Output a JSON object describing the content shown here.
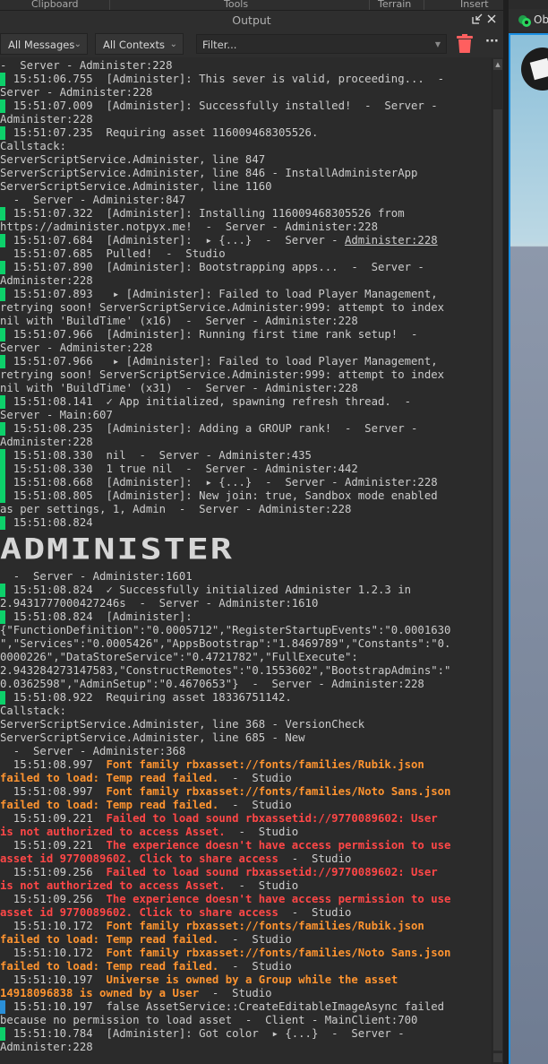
{
  "ribbon": [
    "Clipboard",
    "Tools",
    "Terrain",
    "Insert"
  ],
  "panel": {
    "title": "Output",
    "undock_icon": "undock-icon",
    "close_icon": "close-icon"
  },
  "toolbar": {
    "messages": "All Messages",
    "contexts": "All Contexts",
    "filter_placeholder": "Filter...",
    "clear_icon": "trash-icon",
    "more_icon": "more-icon",
    "more_label": "···"
  },
  "right_panel": {
    "tab_label": "Ob"
  },
  "colors": {
    "info": "#0dd06a",
    "client": "#2a8fd8",
    "warning": "#ff9430",
    "error": "#ff4747"
  },
  "banner": "ADMINISTER",
  "entries": [
    {
      "marker": null,
      "lines": [
        "-  Server - Administer:228"
      ]
    },
    {
      "marker": "info",
      "lines": [
        "  15:51:06.755  [Administer]: This sever is valid, proceeding...  -",
        "Server - Administer:228"
      ]
    },
    {
      "marker": "info",
      "lines": [
        "  15:51:07.009  [Administer]: Successfully installed!  -  Server -",
        "Administer:228"
      ]
    },
    {
      "marker": "info",
      "lines": [
        "  15:51:07.235  Requiring asset 116009468305526.",
        "Callstack:",
        "ServerScriptService.Administer, line 847",
        "ServerScriptService.Administer, line 846 - InstallAdministerApp",
        "ServerScriptService.Administer, line 1160",
        "  -  Server - Administer:847"
      ]
    },
    {
      "marker": "info",
      "lines": [
        "  15:51:07.322  [Administer]: Installing 116009468305526 from",
        "https://administer.notpyx.me!  -  Server - Administer:228"
      ]
    },
    {
      "marker": "info",
      "lines": [
        [
          [
            "  15:51:07.684  [Administer]:  ▸ {...}  -  Server - ",
            ""
          ],
          [
            "Administer:228",
            "u"
          ]
        ]
      ]
    },
    {
      "marker": null,
      "lines": [
        "  15:51:07.685  Pulled!  -  Studio"
      ]
    },
    {
      "marker": "info",
      "lines": [
        "  15:51:07.890  [Administer]: Bootstrapping apps...  -  Server -",
        "Administer:228"
      ]
    },
    {
      "marker": "info",
      "lines": [
        "  15:51:07.893   ▸ [Administer]: Failed to load Player Management,",
        "retrying soon! ServerScriptService.Administer:999: attempt to index",
        "nil with 'BuildTime' (x16)  -  Server - Administer:228"
      ]
    },
    {
      "marker": "info",
      "lines": [
        "  15:51:07.966  [Administer]: Running first time rank setup!  -",
        "Server - Administer:228"
      ]
    },
    {
      "marker": "info",
      "lines": [
        "  15:51:07.966   ▸ [Administer]: Failed to load Player Management,",
        "retrying soon! ServerScriptService.Administer:999: attempt to index",
        "nil with 'BuildTime' (x31)  -  Server - Administer:228"
      ]
    },
    {
      "marker": "info",
      "lines": [
        "  15:51:08.141  ✓ App initialized, spawning refresh thread.  -",
        "Server - Main:607"
      ]
    },
    {
      "marker": "info",
      "lines": [
        "  15:51:08.235  [Administer]: Adding a GROUP rank!  -  Server -",
        "Administer:228"
      ]
    },
    {
      "marker": "info",
      "lines": [
        "  15:51:08.330  nil  -  Server - Administer:435"
      ]
    },
    {
      "marker": "info",
      "lines": [
        "  15:51:08.330  1 true nil  -  Server - Administer:442"
      ]
    },
    {
      "marker": "info",
      "lines": [
        "  15:51:08.668  [Administer]:  ▸ {...}  -  Server - Administer:228"
      ]
    },
    {
      "marker": "info",
      "lines": [
        "  15:51:08.805  [Administer]: New join: true, Sandbox mode enabled",
        "as per settings, 1, Admin  -  Server - Administer:228"
      ]
    },
    {
      "marker": "info",
      "banner": true,
      "lines": [
        "  15:51:08.824",
        "  -  Server - Administer:1601"
      ]
    },
    {
      "marker": "info",
      "lines": [
        "  15:51:08.824  ✓ Successfully initialized Administer 1.2.3 in",
        "2.9431777000427246s  -  Server - Administer:1610"
      ]
    },
    {
      "marker": "info",
      "lines": [
        "  15:51:08.824  [Administer]:",
        "{\"FunctionDefinition\":\"0.0005712\",\"RegisterStartupEvents\":\"0.0001630",
        "\",\"Services\":\"0.0005426\",\"AppsBootstrap\":\"1.8469789\",\"Constants\":\"0.",
        "0000226\",\"DataStoreService\":\"0.4721782\",\"FullExecute\":",
        "2.943284273147583,\"ConstructRemotes\":\"0.1553602\",\"BootstrapAdmins\":\"",
        "0.0362598\",\"AdminSetup\":\"0.4670653\"}  -  Server - Administer:228"
      ]
    },
    {
      "marker": "info",
      "lines": [
        "  15:51:08.922  Requiring asset 18336751142.",
        "Callstack:",
        "ServerScriptService.Administer, line 368 - VersionCheck",
        "ServerScriptService.Administer, line 685 - New",
        "  -  Server - Administer:368"
      ]
    },
    {
      "marker": null,
      "lines": [
        [
          [
            "  15:51:08.997  ",
            ""
          ],
          [
            "Font family rbxasset://fonts/families/Rubik.json",
            "w"
          ]
        ],
        [
          [
            "failed to load: Temp read failed.",
            "w"
          ],
          [
            "  -  Studio",
            ""
          ]
        ]
      ]
    },
    {
      "marker": null,
      "lines": [
        [
          [
            "  15:51:08.997  ",
            ""
          ],
          [
            "Font family rbxasset://fonts/families/Noto Sans.json",
            "w"
          ]
        ],
        [
          [
            "failed to load: Temp read failed.",
            "w"
          ],
          [
            "  -  Studio",
            ""
          ]
        ]
      ]
    },
    {
      "marker": null,
      "lines": [
        [
          [
            "  15:51:09.221  ",
            ""
          ],
          [
            "Failed to load sound rbxassetid://9770089602: User",
            "e"
          ]
        ],
        [
          [
            "is not authorized to access Asset.",
            "e"
          ],
          [
            "  -  Studio",
            ""
          ]
        ]
      ]
    },
    {
      "marker": null,
      "lines": [
        [
          [
            "  15:51:09.221  ",
            ""
          ],
          [
            "The experience doesn't have access permission to use",
            "e"
          ]
        ],
        [
          [
            "asset id 9770089602. Click to share access",
            "e"
          ],
          [
            "  -  Studio",
            ""
          ]
        ]
      ]
    },
    {
      "marker": null,
      "lines": [
        [
          [
            "  15:51:09.256  ",
            ""
          ],
          [
            "Failed to load sound rbxassetid://9770089602: User",
            "e"
          ]
        ],
        [
          [
            "is not authorized to access Asset.",
            "e"
          ],
          [
            "  -  Studio",
            ""
          ]
        ]
      ]
    },
    {
      "marker": null,
      "lines": [
        [
          [
            "  15:51:09.256  ",
            ""
          ],
          [
            "The experience doesn't have access permission to use",
            "e"
          ]
        ],
        [
          [
            "asset id 9770089602. Click to share access",
            "e"
          ],
          [
            "  -  Studio",
            ""
          ]
        ]
      ]
    },
    {
      "marker": null,
      "lines": [
        [
          [
            "  15:51:10.172  ",
            ""
          ],
          [
            "Font family rbxasset://fonts/families/Rubik.json",
            "w"
          ]
        ],
        [
          [
            "failed to load: Temp read failed.",
            "w"
          ],
          [
            "  -  Studio",
            ""
          ]
        ]
      ]
    },
    {
      "marker": null,
      "lines": [
        [
          [
            "  15:51:10.172  ",
            ""
          ],
          [
            "Font family rbxasset://fonts/families/Noto Sans.json",
            "w"
          ]
        ],
        [
          [
            "failed to load: Temp read failed.",
            "w"
          ],
          [
            "  -  Studio",
            ""
          ]
        ]
      ]
    },
    {
      "marker": null,
      "lines": [
        [
          [
            "  15:51:10.197  ",
            ""
          ],
          [
            "Universe is owned by a Group while the asset",
            "w"
          ]
        ],
        [
          [
            "14918096838 is owned by a User",
            "w"
          ],
          [
            "  -  Studio",
            ""
          ]
        ]
      ]
    },
    {
      "marker": "client",
      "lines": [
        "  15:51:10.197  false AssetService::CreateEditableImageAsync failed",
        "because no permission to load asset  -  Client - MainClient:700"
      ]
    },
    {
      "marker": "info",
      "lines": [
        "  15:51:10.784  [Administer]: Got color  ▸ {...}  -  Server -",
        "Administer:228"
      ]
    }
  ]
}
